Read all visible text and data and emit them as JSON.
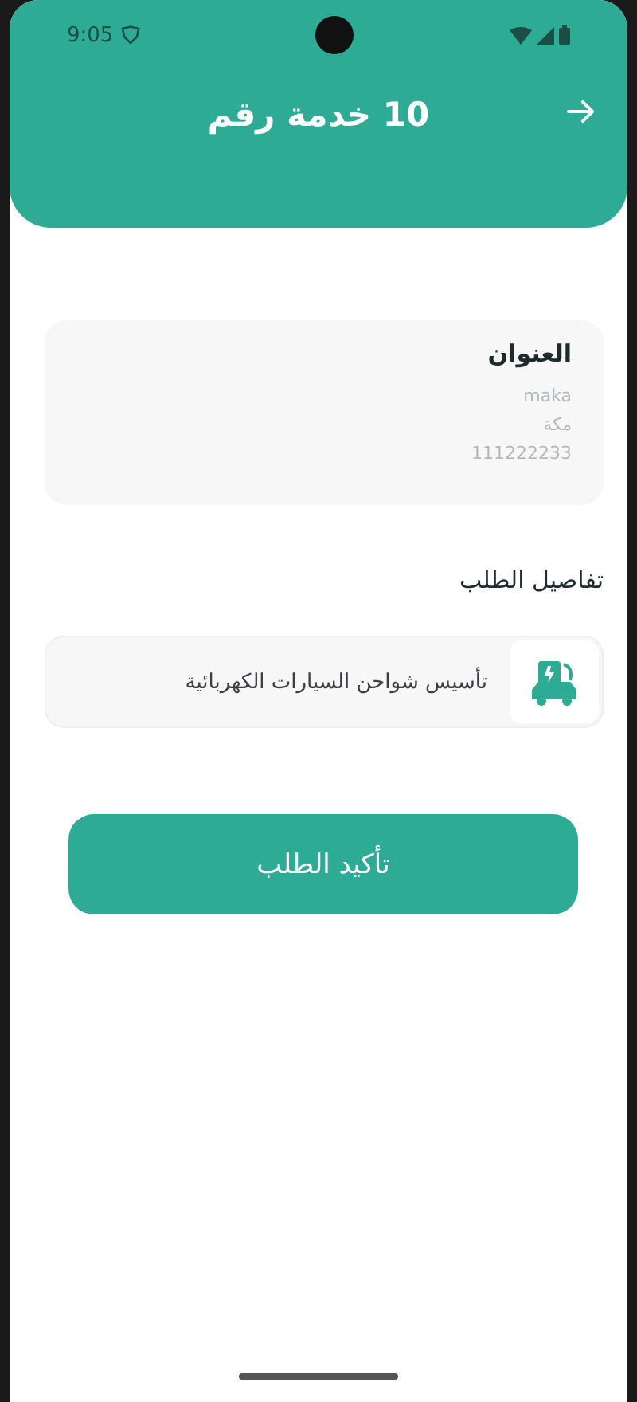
{
  "status_bar": {
    "time": "9:05"
  },
  "header": {
    "title": "10 خدمة رقم"
  },
  "address": {
    "title": "العنوان",
    "lines": [
      "maka",
      "مكة",
      "111222233"
    ]
  },
  "details": {
    "title": "تفاصيل الطلب",
    "items": [
      {
        "name": "تأسيس شواحن السيارات الكهربائية"
      }
    ]
  },
  "confirm_button": {
    "label": "تأكيد الطلب"
  }
}
